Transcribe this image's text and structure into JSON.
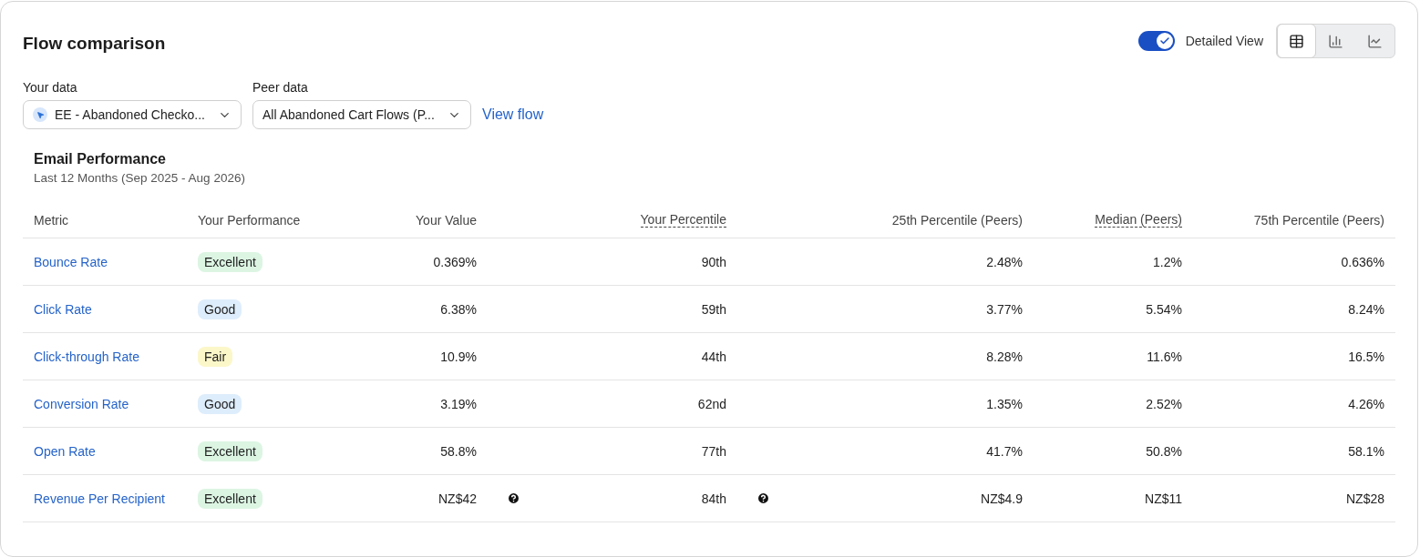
{
  "title": "Flow comparison",
  "toggle": {
    "label": "Detailed View",
    "on": true
  },
  "view_buttons": [
    {
      "kind": "table",
      "selected": true
    },
    {
      "kind": "bar",
      "selected": false
    },
    {
      "kind": "line",
      "selected": false
    }
  ],
  "filters": [
    {
      "label": "Your data",
      "value": "EE - Abandoned Checko...",
      "has_icon": true
    },
    {
      "label": "Peer data",
      "value": "All Abandoned Cart Flows (P...",
      "has_icon": false
    }
  ],
  "view_flow_link": "View flow",
  "section": {
    "title": "Email Performance",
    "subtitle": "Last 12 Months (Sep 2025 - Aug 2026)"
  },
  "columns": [
    {
      "label": "Metric",
      "underlined": false
    },
    {
      "label": "Your Performance",
      "underlined": false
    },
    {
      "label": "Your Value",
      "underlined": false
    },
    {
      "label": "Your Percentile",
      "underlined": true
    },
    {
      "label": "25th Percentile (Peers)",
      "underlined": false
    },
    {
      "label": "Median (Peers)",
      "underlined": true
    },
    {
      "label": "75th Percentile (Peers)",
      "underlined": false
    }
  ],
  "rows": [
    {
      "metric": "Bounce Rate",
      "rating": "Excellent",
      "color": "#dcf5e3",
      "value": "0.369%",
      "value_info": false,
      "percentile": "90th",
      "percentile_info": false,
      "p25": "2.48%",
      "median": "1.2%",
      "p75": "0.636%"
    },
    {
      "metric": "Click Rate",
      "rating": "Good",
      "color": "#deedfb",
      "value": "6.38%",
      "value_info": false,
      "percentile": "59th",
      "percentile_info": false,
      "p25": "3.77%",
      "median": "5.54%",
      "p75": "8.24%"
    },
    {
      "metric": "Click-through Rate",
      "rating": "Fair",
      "color": "#fbf7c9",
      "value": "10.9%",
      "value_info": false,
      "percentile": "44th",
      "percentile_info": false,
      "p25": "8.28%",
      "median": "11.6%",
      "p75": "16.5%"
    },
    {
      "metric": "Conversion Rate",
      "rating": "Good",
      "color": "#deedfb",
      "value": "3.19%",
      "value_info": false,
      "percentile": "62nd",
      "percentile_info": false,
      "p25": "1.35%",
      "median": "2.52%",
      "p75": "4.26%"
    },
    {
      "metric": "Open Rate",
      "rating": "Excellent",
      "color": "#dcf5e3",
      "value": "58.8%",
      "value_info": false,
      "percentile": "77th",
      "percentile_info": false,
      "p25": "41.7%",
      "median": "50.8%",
      "p75": "58.1%"
    },
    {
      "metric": "Revenue Per Recipient",
      "rating": "Excellent",
      "color": "#dcf5e3",
      "value": "NZ$42",
      "value_info": true,
      "percentile": "84th",
      "percentile_info": true,
      "p25": "NZ$4.9",
      "median": "NZ$11",
      "p75": "NZ$28"
    }
  ]
}
